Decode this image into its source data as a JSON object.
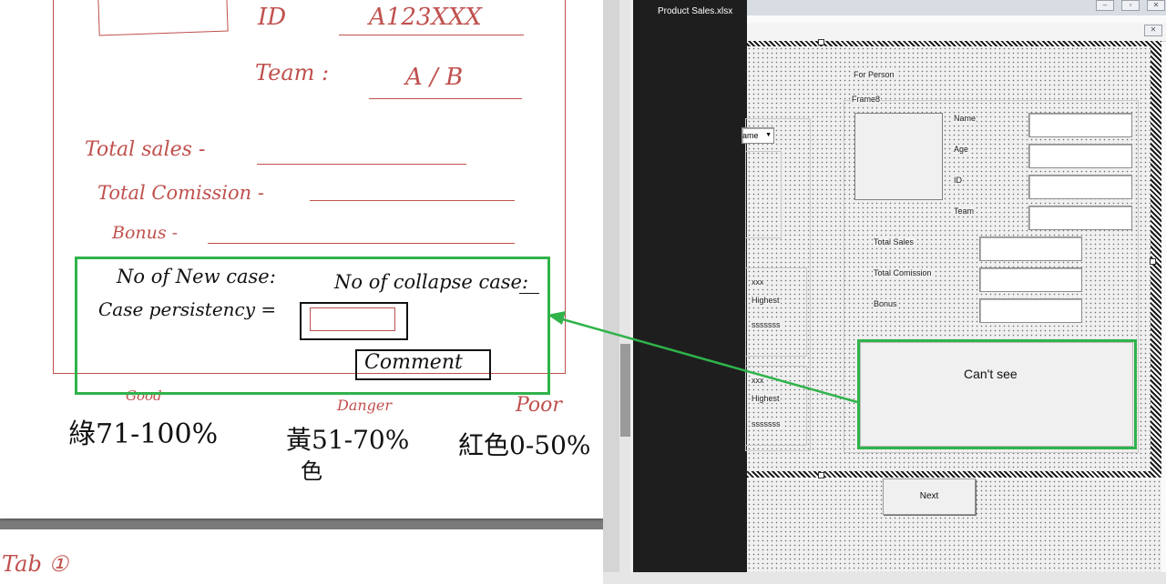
{
  "sketch": {
    "id_label": "ID",
    "id_value": "A123XXX",
    "team_label": "Team :",
    "team_value": "A / B",
    "total_sales": "Total sales -",
    "total_commission": "Total Comission -",
    "bonus": "Bonus -",
    "new_case": "No of New case:",
    "collapse_case": "No of collapse case:",
    "persistency": "Case persistency =",
    "comment": "Comment",
    "good": "Good",
    "danger": "Danger",
    "poor": "Poor",
    "green_range": "綠71-100%",
    "yellow_range": "黃51-70%",
    "yellow_sub": "色",
    "red_range": "紅色0-50%",
    "tab": "Tab ①"
  },
  "taskbar": {
    "file": "Product Sales.xlsx"
  },
  "form": {
    "for_person": "For Person",
    "frame_caption": "Frame8",
    "name": "Name",
    "age": "Age",
    "id": "ID",
    "team": "Team",
    "total_sales": "Total Sales",
    "total_commission": "Total Comission",
    "bonus": "Bonus",
    "combo_partial": "ame",
    "cant_see": "Can't see",
    "next": "Next",
    "list_a": [
      "xxx",
      "Highest",
      "sssssss"
    ],
    "list_b": [
      "xxx",
      "Highest",
      "sssssss"
    ]
  },
  "colors": {
    "highlight": "#2fb34a",
    "ink_red": "#c0504d"
  }
}
